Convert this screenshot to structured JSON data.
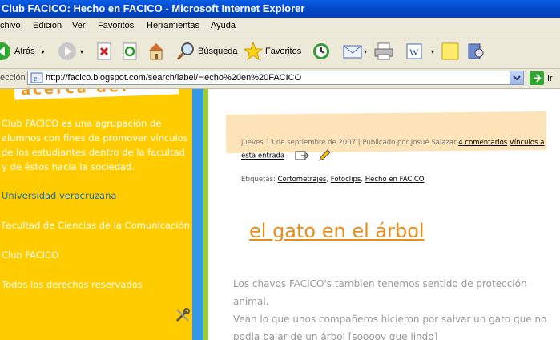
{
  "window": {
    "title": "Club FACICO: Hecho en FACICO - Microsoft Internet Explorer"
  },
  "menu": [
    "chivo",
    "Edición",
    "Ver",
    "Favoritos",
    "Herramientas",
    "Ayuda"
  ],
  "toolbar": {
    "back_label": "Atrás",
    "search_label": "Búsqueda",
    "favorites_label": "Favoritos"
  },
  "address": {
    "label": "ección",
    "url": "http://facico.blogspot.com/search/label/Hecho%20en%20FACICO",
    "go_label": "Ir"
  },
  "sidebar": {
    "heading": "acerca de:",
    "about": "Club FACICO es una agrupación de alumnos con fines de promover vínculos de los estudiantes dentro de la facultad y de éstos hacia la sociedad.",
    "links": [
      "Universidad veracruzana",
      "Facultad de Ciencias de la Comunicación",
      "Club FACICO",
      "Todos los derechos reservados"
    ]
  },
  "post": {
    "meta_prefix": "jueves 13 de septiembre de 2007 | Publicado por Josué Salazar",
    "comments": "4 comentarios",
    "links_label": "Vínculos a esta entrada",
    "labels_prefix": "Etiquetas:",
    "labels": [
      "Cortometrajes",
      "Fotoclips",
      "Hecho en FACICO"
    ],
    "title": "el gato en el árbol",
    "body_lines": [
      "Los chavos FACICO's tambien tenemos sentido de protección",
      "animal.",
      "Vean lo que unos compañeros hicieron por salvar un gato que no",
      "podia bajar de un árbol [sooooy que lindo]"
    ]
  }
}
